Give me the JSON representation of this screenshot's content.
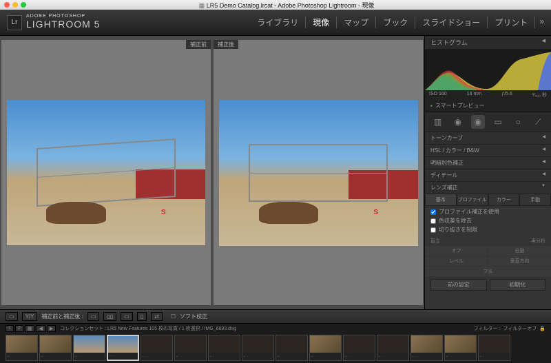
{
  "macbar": {
    "title": "LR5 Demo Catalog.lrcat - Adobe Photoshop Lightroom - 現像"
  },
  "logo": {
    "sup": "ADOBE PHOTOSHOP",
    "main": "LIGHTROOM 5",
    "badge": "Lr"
  },
  "nav": {
    "items": [
      "ライブラリ",
      "現像",
      "マップ",
      "ブック",
      "スライドショー",
      "プリント"
    ],
    "active_index": 1,
    "more": "»"
  },
  "preview": {
    "before_label": "補正前",
    "after_label": "補正後"
  },
  "panel": {
    "histogram_title": "ヒストグラム",
    "histo_info": {
      "iso": "ISO 160",
      "focal": "16 mm",
      "aperture": "ƒ/5.6",
      "shutter": "¹⁄₄₀₀ 秒"
    },
    "smart_preview": "スマートプレビュー",
    "accordions": [
      "トーンカーブ",
      "HSL / カラー / B&W",
      "明暗別色補正",
      "ディテール",
      "レンズ補正"
    ],
    "lens": {
      "tabs": [
        "基本",
        "プロファイル",
        "カラー",
        "手動"
      ],
      "active_tab": 0,
      "checks": [
        {
          "label": "プロファイル補正を使用",
          "checked": true
        },
        {
          "label": "色収差を除去",
          "checked": false
        },
        {
          "label": "切り抜きを制限",
          "checked": false
        }
      ],
      "upright_label": "直立",
      "reanalyze": "再分析",
      "grid": [
        "オフ",
        "自動",
        "レベル",
        "垂直方向",
        "フル"
      ]
    },
    "buttons": {
      "prev": "前の設定",
      "reset": "初期化"
    }
  },
  "toolbar": {
    "compare_label": "補正前と補正後 :",
    "soft_proof": "ソフト校正"
  },
  "filmstrip": {
    "nav": [
      "1",
      "2"
    ],
    "path": "コレクションセット : LR5 New Features   105 枚の写真 / 1 枚選択 / IMG_6693.dng",
    "filter_label": "フィルター :",
    "filter_value": "フィルターオフ"
  }
}
